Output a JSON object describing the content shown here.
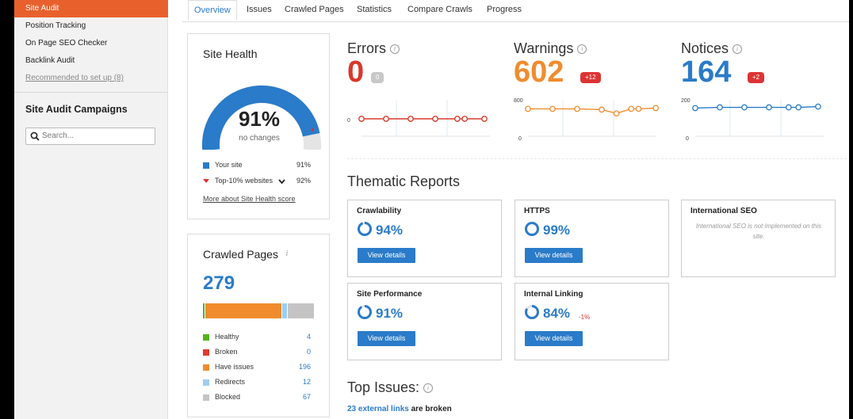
{
  "sidebar": {
    "items": [
      {
        "label": "Site Audit",
        "active": true
      },
      {
        "label": "Position Tracking"
      },
      {
        "label": "On Page SEO Checker"
      },
      {
        "label": "Backlink Audit"
      },
      {
        "label": "Recommended to set up (8)"
      }
    ],
    "campaigns_title": "Site Audit Campaigns",
    "search_placeholder": "Search..."
  },
  "tabs": [
    {
      "label": "Overview",
      "active": true
    },
    {
      "label": "Issues"
    },
    {
      "label": "Crawled Pages"
    },
    {
      "label": "Statistics"
    },
    {
      "label": "Compare Crawls"
    },
    {
      "label": "Progress"
    }
  ],
  "site_health": {
    "title": "Site Health",
    "score": "91%",
    "score_fraction": 0.91,
    "change_text": "no changes",
    "legend": [
      {
        "label": "Your site",
        "value": "91%",
        "color": "#2a7bc9"
      },
      {
        "label": "Top-10% websites",
        "value": "92%",
        "color": "#d33"
      }
    ],
    "more_link": "More about Site Health score"
  },
  "crawled_pages": {
    "title": "Crawled Pages",
    "total": "279",
    "legend": [
      {
        "label": "Healthy",
        "value": "4",
        "color": "#55b21e"
      },
      {
        "label": "Broken",
        "value": "0",
        "color": "#e03b2e"
      },
      {
        "label": "Have issues",
        "value": "196",
        "color": "#f08c2e"
      },
      {
        "label": "Redirects",
        "value": "12",
        "color": "#9fcdf0"
      },
      {
        "label": "Blocked",
        "value": "67",
        "color": "#c4c4c4"
      }
    ]
  },
  "metrics": {
    "errors": {
      "label": "Errors",
      "value": "0",
      "badge": "0",
      "color": "#d9382b",
      "axis": [
        "0"
      ]
    },
    "warnings": {
      "label": "Warnings",
      "value": "602",
      "badge": "+12",
      "color": "#f08c2e",
      "axis": [
        "800",
        "0"
      ]
    },
    "notices": {
      "label": "Notices",
      "value": "164",
      "badge": "+2",
      "color": "#2a7bc9",
      "axis": [
        "200",
        "0"
      ]
    }
  },
  "thematic": {
    "title": "Thematic Reports",
    "reports": [
      {
        "title": "Crawlability",
        "pct": "94%",
        "fraction": 0.94,
        "button": "View details"
      },
      {
        "title": "HTTPS",
        "pct": "99%",
        "fraction": 0.99,
        "button": "View details"
      },
      {
        "title": "International SEO",
        "note": "International SEO is not implemented on this site."
      },
      {
        "title": "Site Performance",
        "pct": "91%",
        "fraction": 0.91,
        "button": "View details"
      },
      {
        "title": "Internal Linking",
        "pct": "84%",
        "fraction": 0.84,
        "delta": "-1%",
        "button": "View details"
      }
    ]
  },
  "top_issues": {
    "title": "Top Issues:",
    "first": {
      "link": "23 external links",
      "rest": " are broken"
    }
  }
}
